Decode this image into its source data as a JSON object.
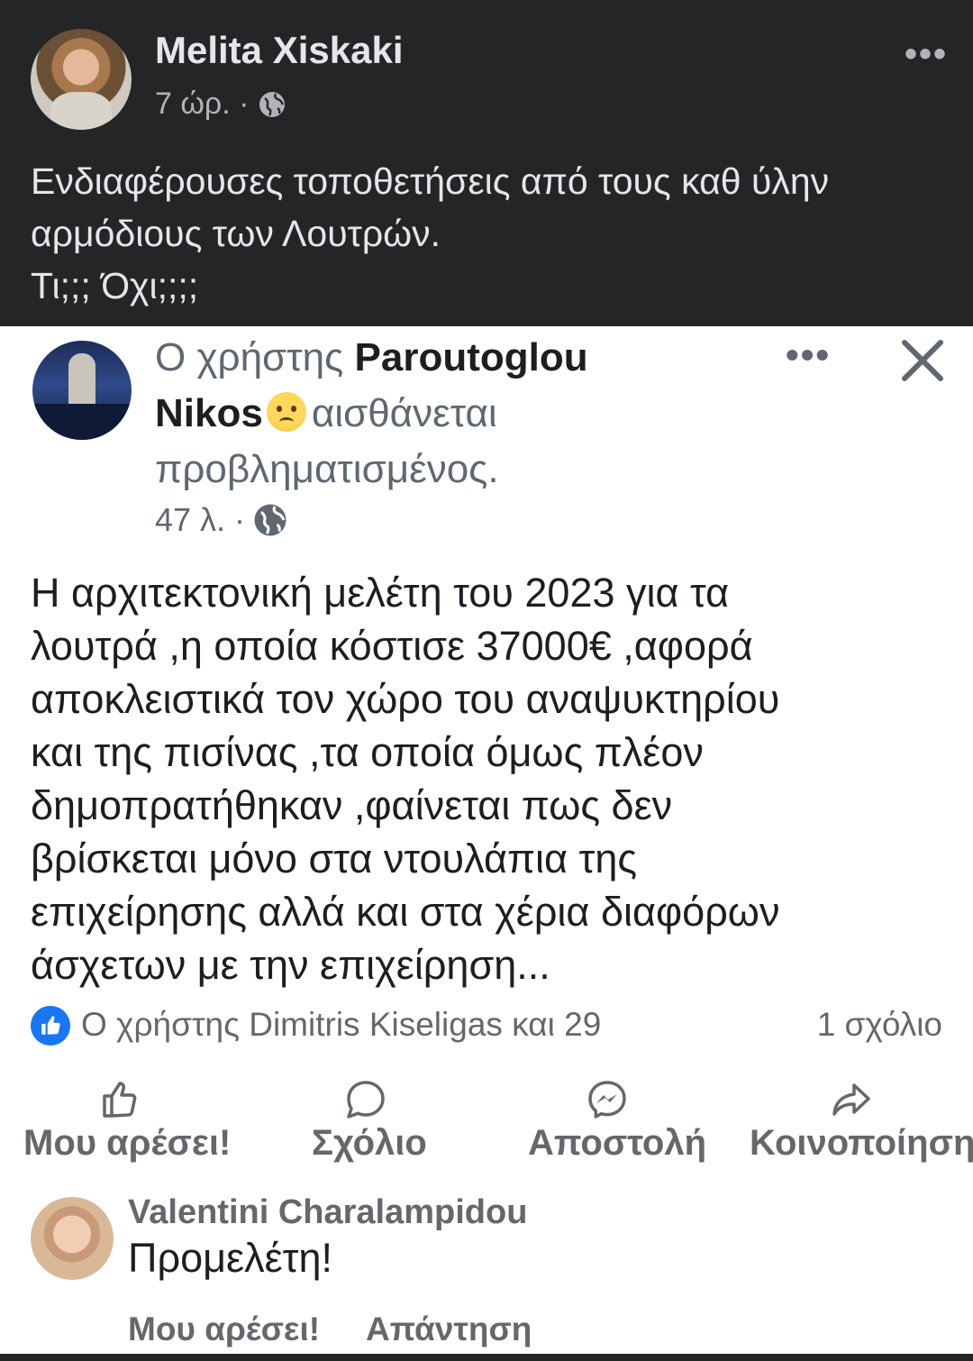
{
  "outer_post": {
    "author": "Melita Xiskaki",
    "time": "7 ώρ. ·",
    "more": "•••",
    "text_lines": [
      "Ενδιαφέρουσες τοποθετήσεις από τους καθ ύλην",
      "αρμόδιους των Λουτρών.",
      "Τι;;; Όχι;;;;"
    ]
  },
  "shared_post": {
    "header_prefix": "Ο χρήστης",
    "author_first": "Paroutoglou",
    "author_last": "Nikos",
    "feeling_line1": "αισθάνεται",
    "feeling_line2": "προβληματισμένος.",
    "time": "47 λ. ·",
    "more": "•••",
    "body_lines": [
      "Η αρχιτεκτονική μελέτη του 2023 για τα",
      "λουτρά ,η οποία κόστισε 37000€ ,αφορά",
      "αποκλειστικά τον χώρο του αναψυκτηρίου",
      "και της πισίνας ,τα οποία όμως πλέον",
      "δημοπρατήθηκαν ,φαίνεται πως δεν",
      "βρίσκεται μόνο στα ντουλάπια της",
      "επιχείρησης αλλά και στα χέρια διαφόρων",
      "άσχετων με την επιχείρηση..."
    ],
    "reactions_text": "Ο χρήστης Dimitris Kiseligas και 29",
    "comments_count": "1 σχόλιο",
    "actions": {
      "like": "Μου αρέσει!",
      "comment": "Σχόλιο",
      "send": "Αποστολή",
      "share": "Κοινοποίηση"
    },
    "comment": {
      "author": "Valentini Charalampidou",
      "text": "Προμελέτη!",
      "like": "Μου αρέσει!",
      "reply": "Απάντηση"
    }
  },
  "colors": {
    "dark_bg": "#242526",
    "dark_text": "#e4e6eb",
    "muted": "#65676b",
    "accent": "#1877f2"
  }
}
